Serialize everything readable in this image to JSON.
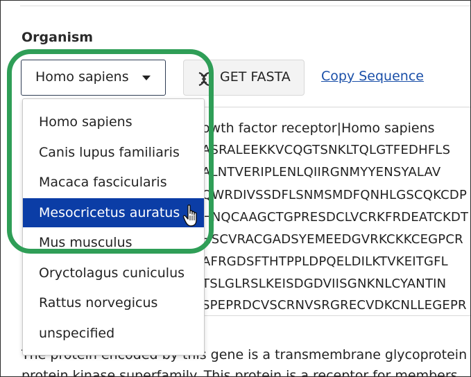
{
  "section_label": "Organism",
  "select": {
    "value": "Homo sapiens"
  },
  "fasta_button": {
    "label": "GET FASTA",
    "icon": "dna-icon"
  },
  "copy_link": {
    "label": "Copy Sequence"
  },
  "dropdown": {
    "options": [
      "Homo sapiens",
      "Canis lupus familiaris",
      "Macaca fascicularis",
      "Mesocricetus auratus",
      "Mus musculus",
      "Oryctolagus cuniculus",
      "Rattus norvegicus",
      "unspecified"
    ],
    "selected": "Mesocricetus auratus"
  },
  "sequence": {
    "header": "owth factor receptor|Homo sapiens",
    "lines": [
      "ASRALEEKKVCQGTSNKLTQLGTFEDHFLS",
      "ALNTVERIPLENLQIIRGNMYYENSYALAV",
      "QWRDIVSSDFLSNMSMDFQNHLGSCQKCDP",
      "HNQCAAGCTGPRESDCLVCRKFRDEATCKDT",
      "HSCVRACGADSYEMEEDGVRKCKKCEGPCR",
      "AFRGDSFTHTPPLDPQELDILKTVKEITGFL",
      "TSLGLRSLKEISDGDVIISGNKNLCYANTIN",
      "SPEPRDCVSCRNVSRGRECVDKCNLLEGEPR"
    ]
  },
  "description": {
    "line1": "The protein encoded by this gene is a transmembrane glycoprotein",
    "line2": "protein kinase superfamily. This protein is a receptor for members"
  },
  "colors": {
    "selected_option": "#0b3da6",
    "highlight_ring": "#2f9e57",
    "link": "#1a4fa8"
  }
}
